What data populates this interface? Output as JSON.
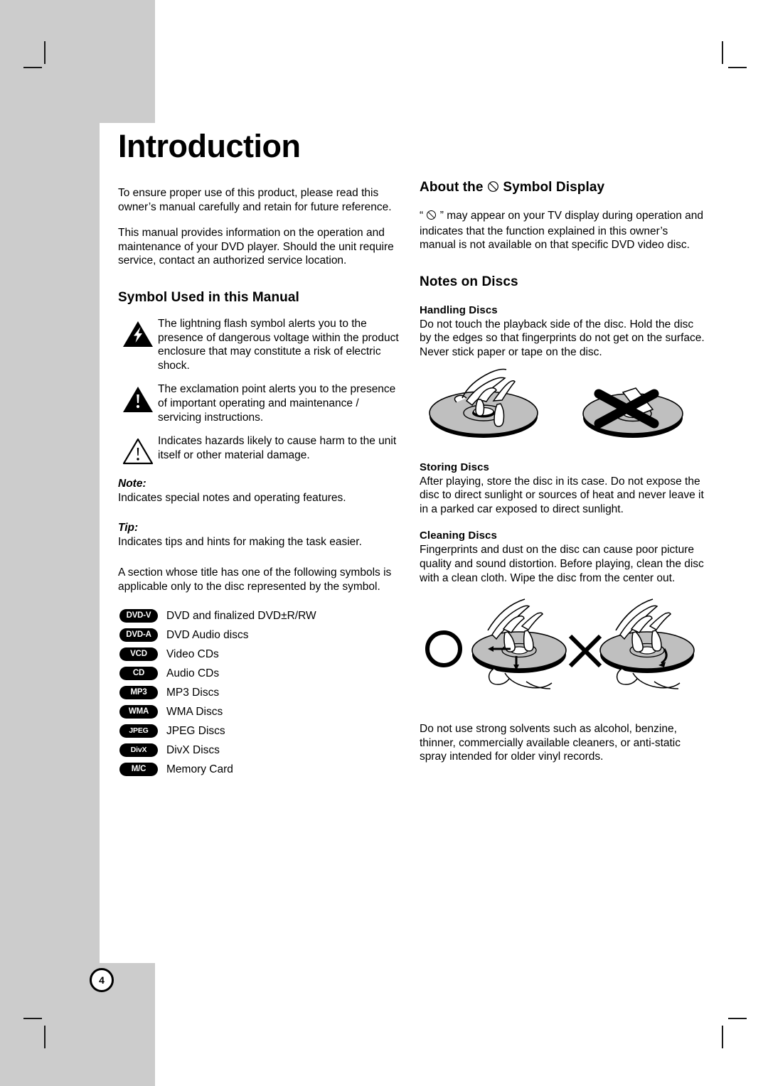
{
  "page": {
    "number": "4",
    "title": "Introduction"
  },
  "left_column": {
    "intro_paragraphs": [
      "To ensure proper use of this product, please read this owner’s manual carefully and retain for future reference.",
      "This manual provides information on the operation and maintenance of your DVD player. Should the unit require service, contact an authorized service location."
    ],
    "symbol_section": {
      "heading": "Symbol Used in this Manual",
      "items": [
        {
          "icon": "lightning-flash-triangle-icon",
          "text": "The lightning flash symbol alerts you to the presence of dangerous voltage within the product enclosure that may constitute a risk of electric shock."
        },
        {
          "icon": "exclamation-filled-triangle-icon",
          "text": "The exclamation point alerts you to the presence of important operating and maintenance / servicing instructions."
        },
        {
          "icon": "exclamation-outline-triangle-icon",
          "text": "Indicates hazards likely to cause harm to the unit itself or other material damage."
        }
      ]
    },
    "note": {
      "label": "Note:",
      "text": "Indicates special notes and operating features."
    },
    "tip": {
      "label": "Tip:",
      "text": "Indicates tips and hints for making the task easier."
    },
    "applicability_text": "A section whose title has one of the following symbols is applicable only to the disc represented by the symbol.",
    "disc_types": [
      {
        "badge": "DVD-V",
        "label": "DVD and finalized DVD±R/RW"
      },
      {
        "badge": "DVD-A",
        "label": "DVD Audio discs"
      },
      {
        "badge": "VCD",
        "label": "Video CDs"
      },
      {
        "badge": "CD",
        "label": "Audio CDs"
      },
      {
        "badge": "MP3",
        "label": "MP3 Discs"
      },
      {
        "badge": "WMA",
        "label": "WMA Discs"
      },
      {
        "badge": "JPEG",
        "label": "JPEG Discs"
      },
      {
        "badge": "DivX",
        "label": "DivX Discs"
      },
      {
        "badge": "M/C",
        "label": "Memory Card"
      }
    ]
  },
  "right_column": {
    "symbol_display": {
      "heading_before": "About the",
      "heading_after": "Symbol Display",
      "body_before": "“",
      "body_after": "” may appear on your TV display during operation and indicates that the function explained in this owner’s manual is not available on that specific DVD video disc."
    },
    "notes_on_discs": {
      "heading": "Notes on Discs",
      "handling": {
        "heading": "Handling Discs",
        "text": "Do not touch the playback side of the disc. Hold the disc by the edges so that fingerprints do not get on the surface. Never stick paper or tape on the disc."
      },
      "storing": {
        "heading": "Storing Discs",
        "text": "After playing, store the disc in its case. Do not expose the disc to direct sunlight or sources of heat and never leave it in a parked car exposed to direct sunlight."
      },
      "cleaning": {
        "heading": "Cleaning Discs",
        "text": "Fingerprints and dust on the disc can cause poor picture quality and sound distortion. Before playing, clean the disc with a clean cloth. Wipe the disc from the center out."
      },
      "solvents_text": "Do not use strong solvents such as alcohol, benzine, thinner, commercially available cleaners, or anti-static spray intended for older vinyl records."
    }
  },
  "colors": {
    "margin_gray": "#cccccc",
    "disc_gray": "#bfbfbf",
    "ink": "#000000"
  }
}
